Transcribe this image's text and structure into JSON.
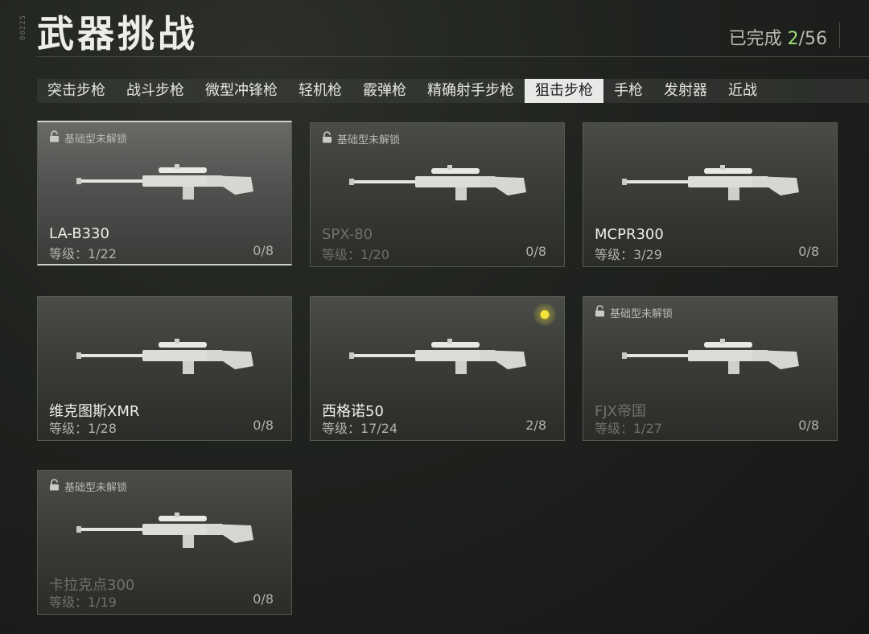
{
  "side_code": "00225",
  "header": {
    "title": "武器挑战",
    "progress_label": "已完成",
    "progress_current": "2",
    "progress_total": "/56"
  },
  "tabs": [
    "突击步枪",
    "战斗步枪",
    "微型冲锋枪",
    "轻机枪",
    "霰弹枪",
    "精确射手步枪",
    "狙击步枪",
    "手枪",
    "发射器",
    "近战"
  ],
  "active_tab": "狙击步枪",
  "lock_text": "基础型未解锁",
  "weapons": [
    {
      "name": "LA-B330",
      "level": "等级：1/22",
      "count": "0/8",
      "locked": true,
      "selected": true,
      "dim": false
    },
    {
      "name": "SPX-80",
      "level": "等级：1/20",
      "count": "0/8",
      "locked": true,
      "selected": false,
      "dim": true
    },
    {
      "name": "MCPR300",
      "level": "等级：3/29",
      "count": "0/8",
      "locked": false,
      "selected": false,
      "dim": false
    },
    {
      "name": "维克图斯XMR",
      "level": "等级：1/28",
      "count": "0/8",
      "locked": false,
      "selected": false,
      "dim": false
    },
    {
      "name": "西格诺50",
      "level": "等级：17/24",
      "count": "2/8",
      "locked": false,
      "selected": false,
      "dim": false,
      "new": true
    },
    {
      "name": "FJX帝国",
      "level": "等级：1/27",
      "count": "0/8",
      "locked": true,
      "selected": false,
      "dim": true
    },
    {
      "name": "卡拉克点300",
      "level": "等级：1/19",
      "count": "0/8",
      "locked": true,
      "selected": false,
      "dim": true
    }
  ],
  "colors": {
    "accent_green": "#9fe07a",
    "new_dot": "#f4e43a"
  }
}
